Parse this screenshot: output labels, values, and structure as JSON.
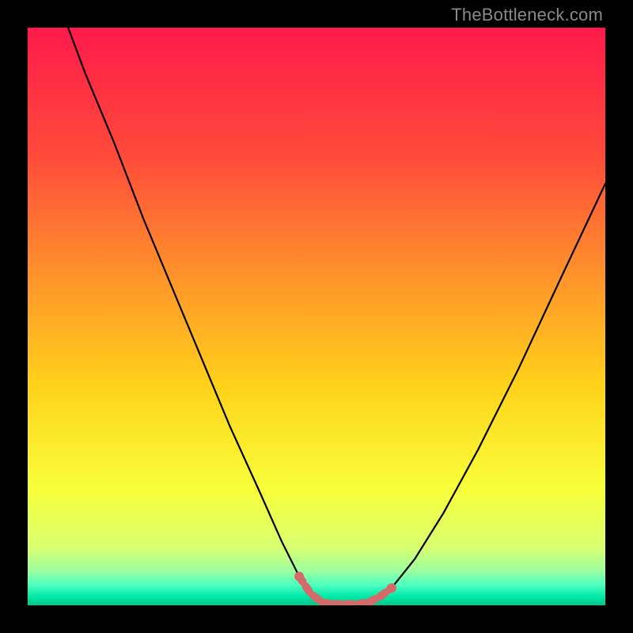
{
  "watermark": "TheBottleneck.com",
  "chart_data": {
    "type": "line",
    "title": "",
    "xlabel": "",
    "ylabel": "",
    "xlim": [
      0,
      100
    ],
    "ylim": [
      0,
      100
    ],
    "series": [
      {
        "name": "curve",
        "x": [
          7,
          10,
          15,
          20,
          25,
          30,
          35,
          40,
          44,
          47,
          49,
          51,
          53,
          55,
          57,
          59,
          61,
          63,
          67,
          72,
          78,
          85,
          92,
          100
        ],
        "y": [
          100,
          92,
          80,
          67,
          55,
          43,
          31,
          20,
          11,
          5,
          2,
          0.5,
          0.2,
          0.2,
          0.2,
          0.5,
          1.5,
          3,
          8,
          16,
          27,
          41,
          56,
          73
        ]
      }
    ],
    "highlight_segment": {
      "name": "bottom-band",
      "x": [
        47,
        49,
        51,
        53,
        55,
        57,
        59,
        61,
        63
      ],
      "y": [
        5,
        2,
        0.5,
        0.2,
        0.2,
        0.2,
        0.5,
        1.5,
        3
      ],
      "color": "#d46a6a"
    },
    "gradient_stops": [
      {
        "offset": 0.0,
        "color": "#ff1a4b"
      },
      {
        "offset": 0.22,
        "color": "#ff4a3a"
      },
      {
        "offset": 0.45,
        "color": "#ff9a2a"
      },
      {
        "offset": 0.62,
        "color": "#ffd21a"
      },
      {
        "offset": 0.8,
        "color": "#f8ff3a"
      },
      {
        "offset": 0.9,
        "color": "#d8ff70"
      },
      {
        "offset": 0.94,
        "color": "#9dffa0"
      },
      {
        "offset": 0.965,
        "color": "#4dffc0"
      },
      {
        "offset": 0.985,
        "color": "#00e8a8"
      },
      {
        "offset": 1.0,
        "color": "#00c88a"
      }
    ]
  }
}
